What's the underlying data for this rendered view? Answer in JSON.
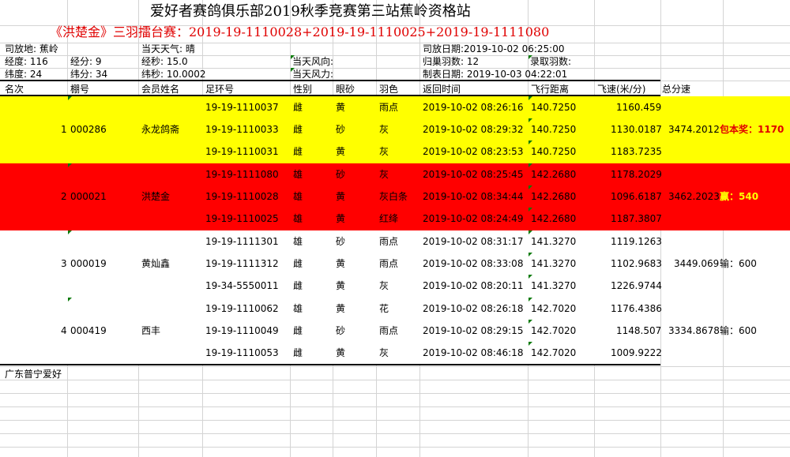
{
  "title": "爱好者赛鸽俱乐部2019秋季竞赛第三站蕉岭资格站",
  "subtitle": "《洪楚金》三羽擂台赛：2019-19-1110028+2019-19-1110025+2019-19-1111080",
  "info": {
    "release_place": "司放地: 蕉岭",
    "weather": "当天天气: 晴",
    "release_date": "司放日期:2019-10-02 06:25:00",
    "longitude": "经度: 116",
    "long_min": "经分: 9",
    "long_sec": "经秒: 15.0",
    "wind_dir": "当天风向:",
    "returned": "归巢羽数: 12",
    "recorded": "录取羽数:",
    "latitude": "纬度:  24",
    "lat_min": "纬分: 34",
    "lat_sec": "纬秒: 10.0002",
    "wind_force": "当天风力:",
    "made_date": "制表日期: 2019-10-03 04:22:01"
  },
  "headers": {
    "rank": "名次",
    "shed": "棚号",
    "member": "会员姓名",
    "ring": "足环号",
    "sex": "性别",
    "eye": "眼砂",
    "color": "羽色",
    "return_time": "返回时间",
    "distance": "飞行距离",
    "speed": "飞速(米/分)",
    "total": "总分速"
  },
  "groups": [
    {
      "rank": "1",
      "shed": "000286",
      "member": "永龙鸽斋",
      "total": "3474.2012",
      "result_label": "包本奖：1170",
      "rows": [
        {
          "ring": "19-19-1110037",
          "sex": "雌",
          "eye": "黄",
          "color": "雨点",
          "time": "2019-10-02 08:26:16",
          "distance": "140.7250",
          "speed": "1160.459"
        },
        {
          "ring": "19-19-1110033",
          "sex": "雌",
          "eye": "砂",
          "color": "灰",
          "time": "2019-10-02 08:29:32",
          "distance": "140.7250",
          "speed": "1130.0187"
        },
        {
          "ring": "19-19-1110031",
          "sex": "雌",
          "eye": "黄",
          "color": "灰",
          "time": "2019-10-02 08:23:53",
          "distance": "140.7250",
          "speed": "1183.7235"
        }
      ]
    },
    {
      "rank": "2",
      "shed": "000021",
      "member": "洪楚金",
      "total": "3462.2023",
      "result_label": "赢：540",
      "rows": [
        {
          "ring": "19-19-1111080",
          "sex": "雄",
          "eye": "砂",
          "color": "灰",
          "time": "2019-10-02 08:25:45",
          "distance": "142.2680",
          "speed": "1178.2029"
        },
        {
          "ring": "19-19-1110028",
          "sex": "雄",
          "eye": "黄",
          "color": "灰白条",
          "time": "2019-10-02 08:34:44",
          "distance": "142.2680",
          "speed": "1096.6187"
        },
        {
          "ring": "19-19-1110025",
          "sex": "雄",
          "eye": "黄",
          "color": "红绛",
          "time": "2019-10-02 08:24:49",
          "distance": "142.2680",
          "speed": "1187.3807"
        }
      ]
    },
    {
      "rank": "3",
      "shed": "000019",
      "member": "黄灿鑫",
      "total": "3449.069",
      "result_label": "输：600",
      "rows": [
        {
          "ring": "19-19-1111301",
          "sex": "雄",
          "eye": "砂",
          "color": "雨点",
          "time": "2019-10-02 08:31:17",
          "distance": "141.3270",
          "speed": "1119.1263"
        },
        {
          "ring": "19-19-1111312",
          "sex": "雌",
          "eye": "黄",
          "color": "雨点",
          "time": "2019-10-02 08:33:08",
          "distance": "141.3270",
          "speed": "1102.9683"
        },
        {
          "ring": "19-34-5550011",
          "sex": "雌",
          "eye": "黄",
          "color": "灰",
          "time": "2019-10-02 08:20:11",
          "distance": "141.3270",
          "speed": "1226.9744"
        }
      ]
    },
    {
      "rank": "4",
      "shed": "000419",
      "member": "西丰",
      "total": "3334.8678",
      "result_label": "输：600",
      "rows": [
        {
          "ring": "19-19-1110062",
          "sex": "雄",
          "eye": "黄",
          "color": "花",
          "time": "2019-10-02 08:26:18",
          "distance": "142.7020",
          "speed": "1176.4386"
        },
        {
          "ring": "19-19-1110049",
          "sex": "雌",
          "eye": "砂",
          "color": "雨点",
          "time": "2019-10-02 08:29:15",
          "distance": "142.7020",
          "speed": "1148.507"
        },
        {
          "ring": "19-19-1110053",
          "sex": "雌",
          "eye": "黄",
          "color": "灰",
          "time": "2019-10-02 08:46:18",
          "distance": "142.7020",
          "speed": "1009.9222"
        }
      ]
    }
  ],
  "footer": "广东普宁爱好",
  "colors": {
    "yellow_band": "#ffff00",
    "red_band": "#ff0000",
    "subtitle_red": "#e00000",
    "gridline": "#d4d4d4",
    "cell_marker": "#0a7a0a"
  }
}
